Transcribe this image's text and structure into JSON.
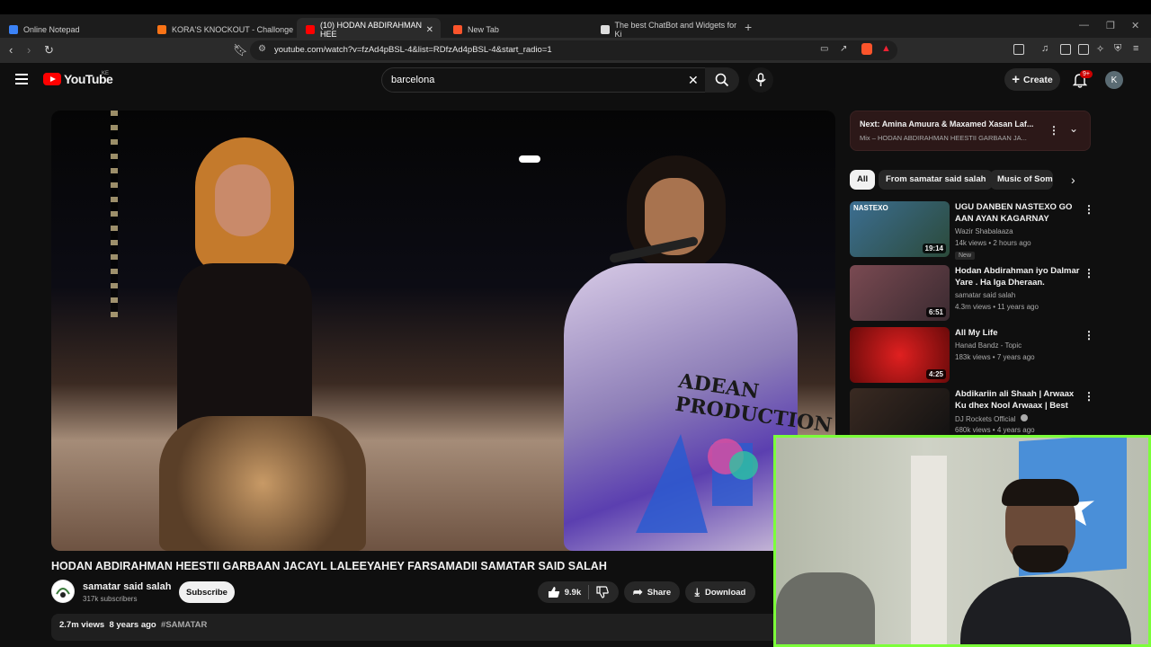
{
  "browser": {
    "tabs": [
      {
        "title": "Online Notepad",
        "color": "#3b82f6"
      },
      {
        "title": "KORA'S KNOCKOUT - Challonge",
        "color": "#f97316"
      },
      {
        "title": "(10) HODAN ABDIRAHMAN HEE",
        "color": "#ff0000"
      },
      {
        "title": "New Tab",
        "color": "#fb542b"
      },
      {
        "title": "The best ChatBot and Widgets for Ki",
        "color": "#dddddd"
      }
    ],
    "url": "youtube.com/watch?v=fzAd4pBSL-4&list=RDfzAd4pBSL-4&start_radio=1"
  },
  "header": {
    "logo_text": "YouTube",
    "country": "KE",
    "search_value": "barcelona",
    "create_label": "Create",
    "notif_badge": "9+",
    "avatar_letter": "K"
  },
  "video": {
    "title": "HODAN ABDIRAHMAN HEESTII GARBAAN JACAYL LALEEYAHEY FARSAMADII SAMATAR SAID SALAH",
    "overlay_text": "ADEAN PRODUCTION",
    "channel": "samatar said salah",
    "subscribers": "317k subscribers",
    "subscribe_label": "Subscribe",
    "likes": "9.9k",
    "share_label": "Share",
    "download_label": "Download",
    "views": "2.7m views",
    "age": "8 years ago",
    "hashtag": "#SAMATAR"
  },
  "next": {
    "prefix": "Next:",
    "title": "Amina Amuura & Maxamed Xasan Laf...",
    "sub": "Mix – HODAN ABDIRAHMAN HEESTII GARBAAN JA..."
  },
  "chips": [
    "All",
    "From samatar said salah",
    "Music of Somal"
  ],
  "recommendations": [
    {
      "title": "UGU DANBEN NASTEXO GO AAN AYAN KAGARNAY WALIB...",
      "channel": "Wazir Shabalaaza",
      "meta": "14k views • 2 hours ago",
      "duration": "19:14",
      "badge": "New",
      "thumb_text": "NASTEXO",
      "thumb_bg": "#3c6e91"
    },
    {
      "title": "Hodan Abdirahman iyo Dalmar Yare . Ha Iga Dheraan. Directe...",
      "channel": "samatar said salah",
      "meta": "4.3m views • 11 years ago",
      "duration": "6:51",
      "thumb_bg": "#7a4a52"
    },
    {
      "title": "All My Life",
      "channel": "Hanad Bandz - Topic",
      "meta": "183k views • 7 years ago",
      "duration": "4:25",
      "thumb_bg": "#a01010"
    },
    {
      "title": "Abdikariin ali Shaah | Arwaax Ku dhex Nool Arwaax | Best Song ...",
      "channel": "DJ Rockets Official",
      "meta": "680k views • 4 years ago",
      "thumb_bg": "#3a2a22"
    }
  ]
}
